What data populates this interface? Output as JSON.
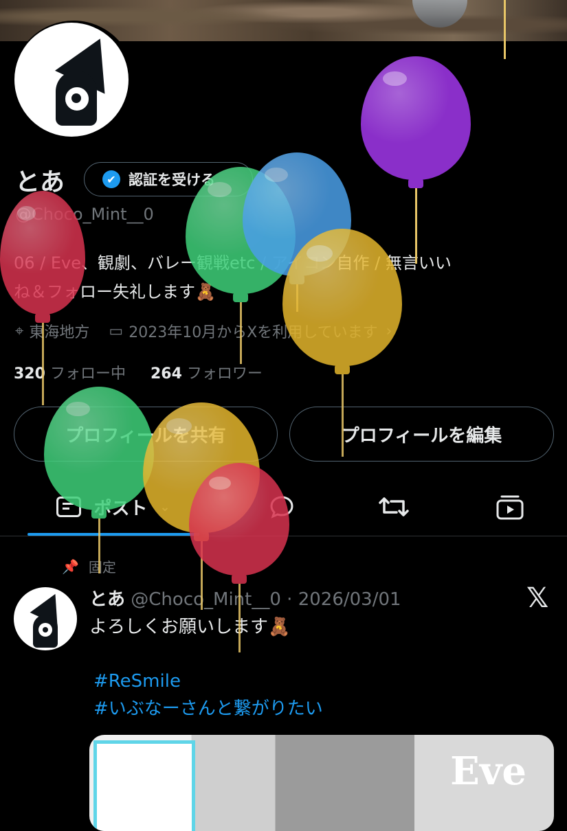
{
  "profile": {
    "name": "とあ",
    "verify_label": "認証を受ける",
    "handle": "@Choco_Mint__0",
    "bio_line1": "06 / Eve、観劇、バレー観戦etc / アイコン自作 / 無言いい",
    "bio_line2": "ね＆フォロー失礼します🧸",
    "location": "東海地方",
    "joined": "2023年10月からXを利用しています",
    "following_count": "320",
    "following_label": "フォロー中",
    "followers_count": "264",
    "followers_label": "フォロワー"
  },
  "actions": {
    "share_label": "プロフィールを共有",
    "edit_label": "プロフィールを編集"
  },
  "tabs": {
    "posts_label": "ポスト"
  },
  "post": {
    "pinned_label": "固定",
    "author": "とあ",
    "meta": "@Choco_Mint__0 · 2026/03/01",
    "text": "よろしくお願いします🧸",
    "tags": [
      "#ReSmile",
      "#いぶなーさんと繋がりたい"
    ],
    "media_logo": "Eve"
  },
  "colors": {
    "accent": "#1d9bf0",
    "background": "#000000",
    "text": "#e7e9ea",
    "muted": "#71767b",
    "border": "#536471"
  }
}
